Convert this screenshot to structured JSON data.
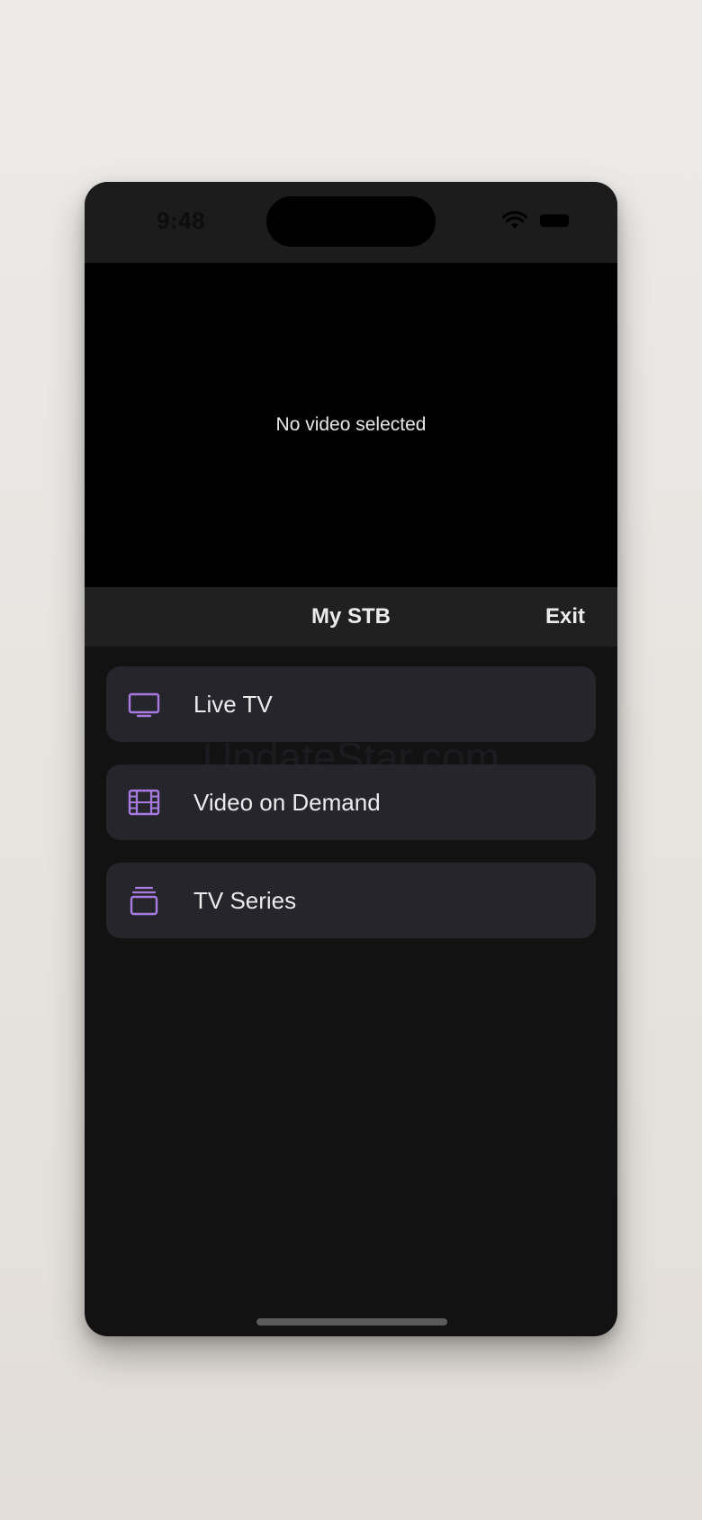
{
  "status_bar": {
    "time": "9:48",
    "wifi_icon": "wifi-icon",
    "battery_icon": "battery-icon"
  },
  "player": {
    "message": "No video selected"
  },
  "navbar": {
    "title": "My STB",
    "exit_label": "Exit"
  },
  "watermark": "UpdateStar.com",
  "menu": {
    "items": [
      {
        "label": "Live TV",
        "icon": "tv-icon"
      },
      {
        "label": "Video on Demand",
        "icon": "film-icon"
      },
      {
        "label": "TV Series",
        "icon": "stack-icon"
      }
    ]
  },
  "colors": {
    "accent": "#a77be0",
    "background": "#121212",
    "card": "#25252b",
    "text": "#ececec"
  }
}
